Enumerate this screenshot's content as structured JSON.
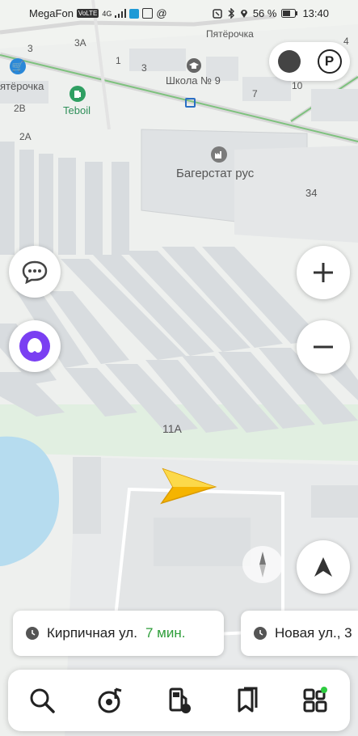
{
  "status_bar": {
    "carrier": "MegaFon",
    "volte": "VoLTE",
    "network": "4G",
    "battery": "56 %",
    "time": "13:40"
  },
  "map_labels": {
    "pyaterochka_top": "Пятёрочка",
    "pyaterochka_left": "ятёрочка",
    "teboil": "Teboil",
    "school": "Школа № 9",
    "bagerstat": "Багерстат рус",
    "n3a": "3А",
    "n3_top": "3",
    "n1": "1",
    "n3_mid": "3",
    "n7": "7",
    "n10": "10",
    "n2v": "2В",
    "n2a": "2А",
    "n34": "34",
    "n11a": "11А",
    "n4": "4"
  },
  "route_cards": [
    {
      "street": "Кирпичная ул.",
      "time": "7 мин."
    },
    {
      "street": "Новая ул., 3",
      "time": ""
    }
  ],
  "colors": {
    "route_time": "#2e9e3a",
    "arrow": "#f5b400",
    "alice": "#7a3ff2"
  }
}
